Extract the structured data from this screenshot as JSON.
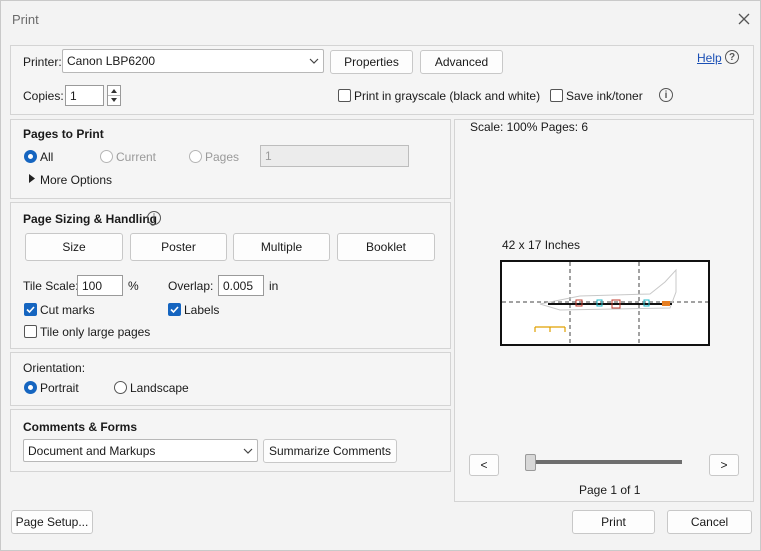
{
  "window": {
    "title": "Print"
  },
  "printer": {
    "label": "Printer:",
    "selected": "Canon LBP6200",
    "properties_label": "Properties",
    "advanced_label": "Advanced",
    "help_label": "Help",
    "copies_label": "Copies:",
    "copies_value": "1",
    "grayscale_label": "Print in grayscale (black and white)",
    "grayscale_checked": false,
    "save_ink_label": "Save ink/toner",
    "save_ink_checked": false
  },
  "pages_to_print": {
    "heading": "Pages to Print",
    "all_label": "All",
    "current_label": "Current",
    "pages_label": "Pages",
    "pages_value": "1",
    "selected": "All",
    "more_options_label": "More Options"
  },
  "sizing": {
    "heading": "Page Sizing & Handling",
    "buttons": [
      "Size",
      "Poster",
      "Multiple",
      "Booklet"
    ],
    "active_button": "Poster",
    "tile_scale_label": "Tile Scale:",
    "tile_scale_value": "100",
    "tile_scale_unit": "%",
    "overlap_label": "Overlap:",
    "overlap_value": "0.005",
    "overlap_unit": "in",
    "cut_marks_label": "Cut marks",
    "cut_marks_checked": true,
    "labels_label": "Labels",
    "labels_checked": true,
    "tile_large_label": "Tile only large pages",
    "tile_large_checked": false
  },
  "orientation": {
    "heading": "Orientation:",
    "portrait_label": "Portrait",
    "landscape_label": "Landscape",
    "selected": "Portrait"
  },
  "comments": {
    "heading": "Comments & Forms",
    "selected": "Document and Markups",
    "summarize_label": "Summarize Comments"
  },
  "preview": {
    "scale_text": "Scale: 100% Pages: 6",
    "paper_size_text": "42 x 17 Inches",
    "prev_label": "<",
    "next_label": ">",
    "page_indicator": "Page 1 of 1",
    "slider_position_fraction": 0.0
  },
  "footer": {
    "page_setup_label": "Page Setup...",
    "print_label": "Print",
    "cancel_label": "Cancel"
  },
  "colors": {
    "accent": "#1565c0",
    "link": "#1a4fb5"
  }
}
